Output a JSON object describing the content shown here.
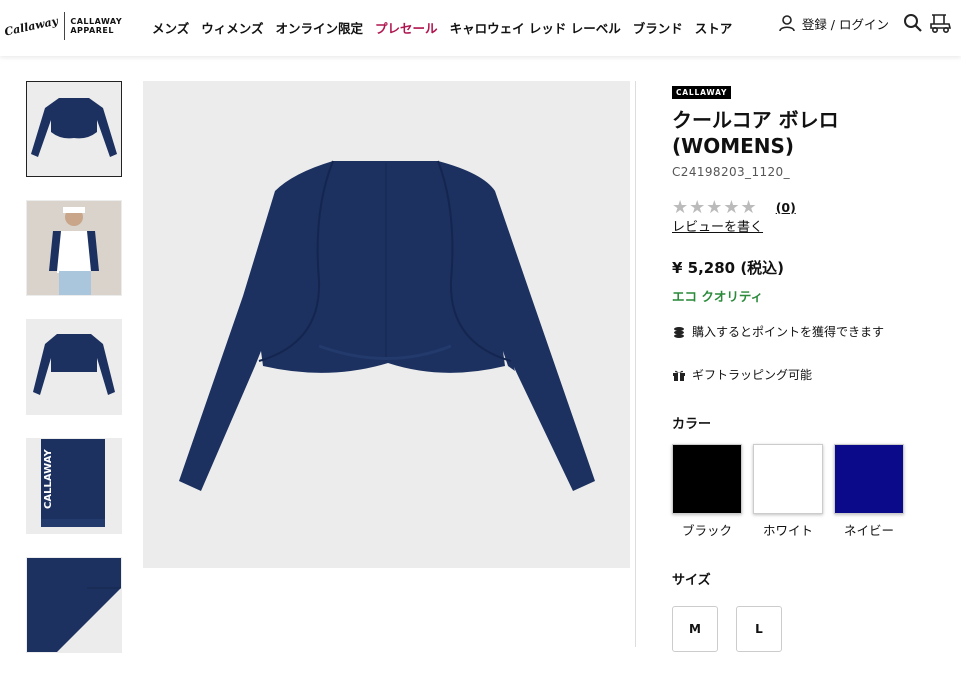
{
  "header": {
    "logo_script": "Callaway",
    "logo_line1": "CALLAWAY",
    "logo_line2": "APPAREL",
    "nav": [
      "メンズ",
      "ウィメンズ",
      "オンライン限定",
      "プレセール",
      "キャロウェイ レッド レーベル",
      "ブランド",
      "ストア"
    ],
    "login_label": "登録 / ログイン"
  },
  "gallery": {
    "thumb_label_text": "CALLAWAY",
    "active_index": 0
  },
  "product": {
    "brand_badge": "CALLAWAY",
    "title_line1": "クールコア ボレロ",
    "title_line2": "(WOMENS)",
    "sku": "C24198203_1120_",
    "rating_stars": "★★★★★",
    "rating_value": 0,
    "review_count": "(0)",
    "write_review": "レビューを書く",
    "price": "¥ 5,280 (税込)",
    "eco_label": "エコ クオリティ",
    "points_text": "購入するとポイントを獲得できます",
    "gift_text": "ギフトラッピング可能",
    "color_label": "カラー",
    "colors": [
      {
        "name": "ブラック",
        "hex": "#000000"
      },
      {
        "name": "ホワイト",
        "hex": "#ffffff"
      },
      {
        "name": "ネイビー",
        "hex": "#0a0a8a"
      }
    ],
    "size_label": "サイズ",
    "sizes": [
      "M",
      "L"
    ]
  },
  "colors": {
    "garment_navy": "#1c3160",
    "presale_accent": "#b0154f",
    "eco_green": "#2a8a3a"
  }
}
